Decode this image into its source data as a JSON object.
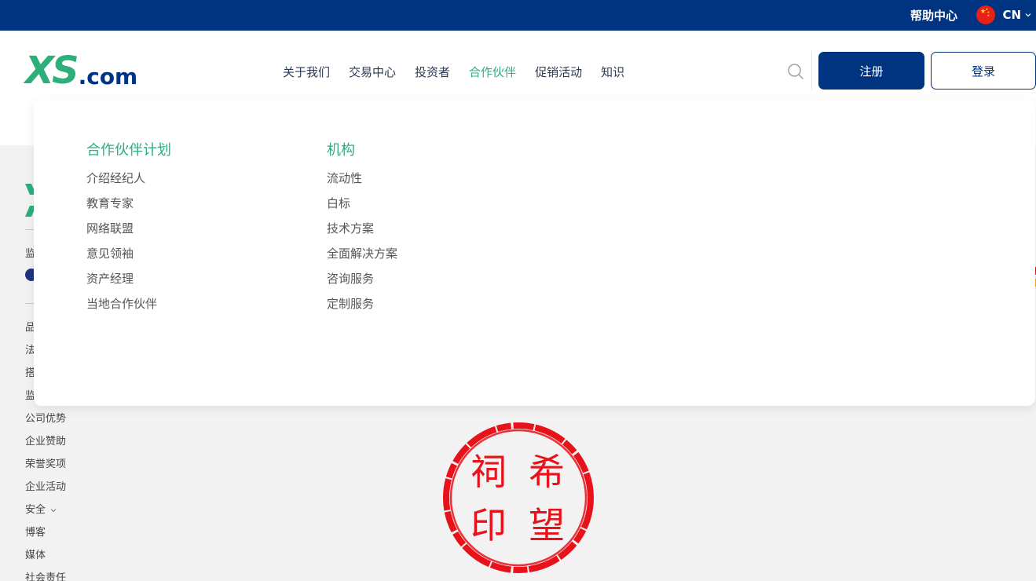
{
  "topbar": {
    "help_center": "帮助中心",
    "language_code": "CN"
  },
  "header": {
    "logo_main": "XS",
    "logo_suffix": ".com",
    "nav": [
      {
        "label": "关于我们",
        "active": false
      },
      {
        "label": "交易中心",
        "active": false
      },
      {
        "label": "投资者",
        "active": false
      },
      {
        "label": "合作伙伴",
        "active": true
      },
      {
        "label": "促销活动",
        "active": false
      },
      {
        "label": "知识",
        "active": false
      }
    ],
    "register_label": "注册",
    "login_label": "登录"
  },
  "mega_menu": {
    "columns": [
      {
        "heading": "合作伙伴计划",
        "links": [
          "介绍经纪人",
          "教育专家",
          "网络联盟",
          "意见领袖",
          "资产经理",
          "当地合作伙伴"
        ]
      },
      {
        "heading": "机构",
        "links": [
          "流动性",
          "白标",
          "技术方案",
          "全面解决方案",
          "咨询服务",
          "定制服务"
        ]
      }
    ]
  },
  "background": {
    "partial_labels": [
      "监",
      "品",
      "法",
      "搭",
      "监"
    ],
    "footer_links": [
      "公司优势",
      "企业赞助",
      "荣誉奖项",
      "企业活动",
      "安全",
      "博客",
      "媒体",
      "社会责任"
    ]
  },
  "stamp": {
    "chars": [
      "祠",
      "希",
      "印",
      "望"
    ]
  },
  "colors": {
    "brand_blue": "#003380",
    "brand_green": "#2dae7a",
    "stamp_red": "#e8121a"
  }
}
